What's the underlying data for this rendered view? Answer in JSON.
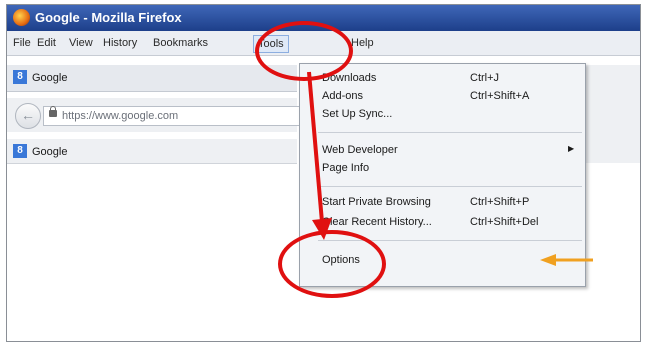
{
  "window": {
    "title": "Google - Mozilla Firefox"
  },
  "menubar": {
    "items": [
      "File",
      "Edit",
      "View",
      "History",
      "Bookmarks",
      "Tools",
      "Help"
    ]
  },
  "tab": {
    "label": "Google",
    "favicon": "8"
  },
  "navbar": {
    "url": "https://www.google.com"
  },
  "bookmarks": {
    "label": "Google",
    "favicon": "8"
  },
  "tools_menu": {
    "items": [
      {
        "label": "Downloads",
        "shortcut": "Ctrl+J"
      },
      {
        "label": "Add-ons",
        "shortcut": "Ctrl+Shift+A"
      },
      {
        "label": "Set Up Sync...",
        "shortcut": ""
      },
      {
        "label": "Web Developer",
        "shortcut": ""
      },
      {
        "label": "Page Info",
        "shortcut": ""
      },
      {
        "label": "Start Private Browsing",
        "shortcut": "Ctrl+Shift+P"
      },
      {
        "label": "Clear Recent History...",
        "shortcut": "Ctrl+Shift+Del"
      },
      {
        "label": "Options",
        "shortcut": ""
      }
    ]
  },
  "annotations": {
    "circle_color": "#e01010",
    "arrow_color": "#e01010",
    "side_arrow_color": "#f0a020"
  },
  "icons": {
    "back": "back-arrow-icon",
    "lock": "lock-icon",
    "submenu": "submenu-arrow-icon"
  }
}
